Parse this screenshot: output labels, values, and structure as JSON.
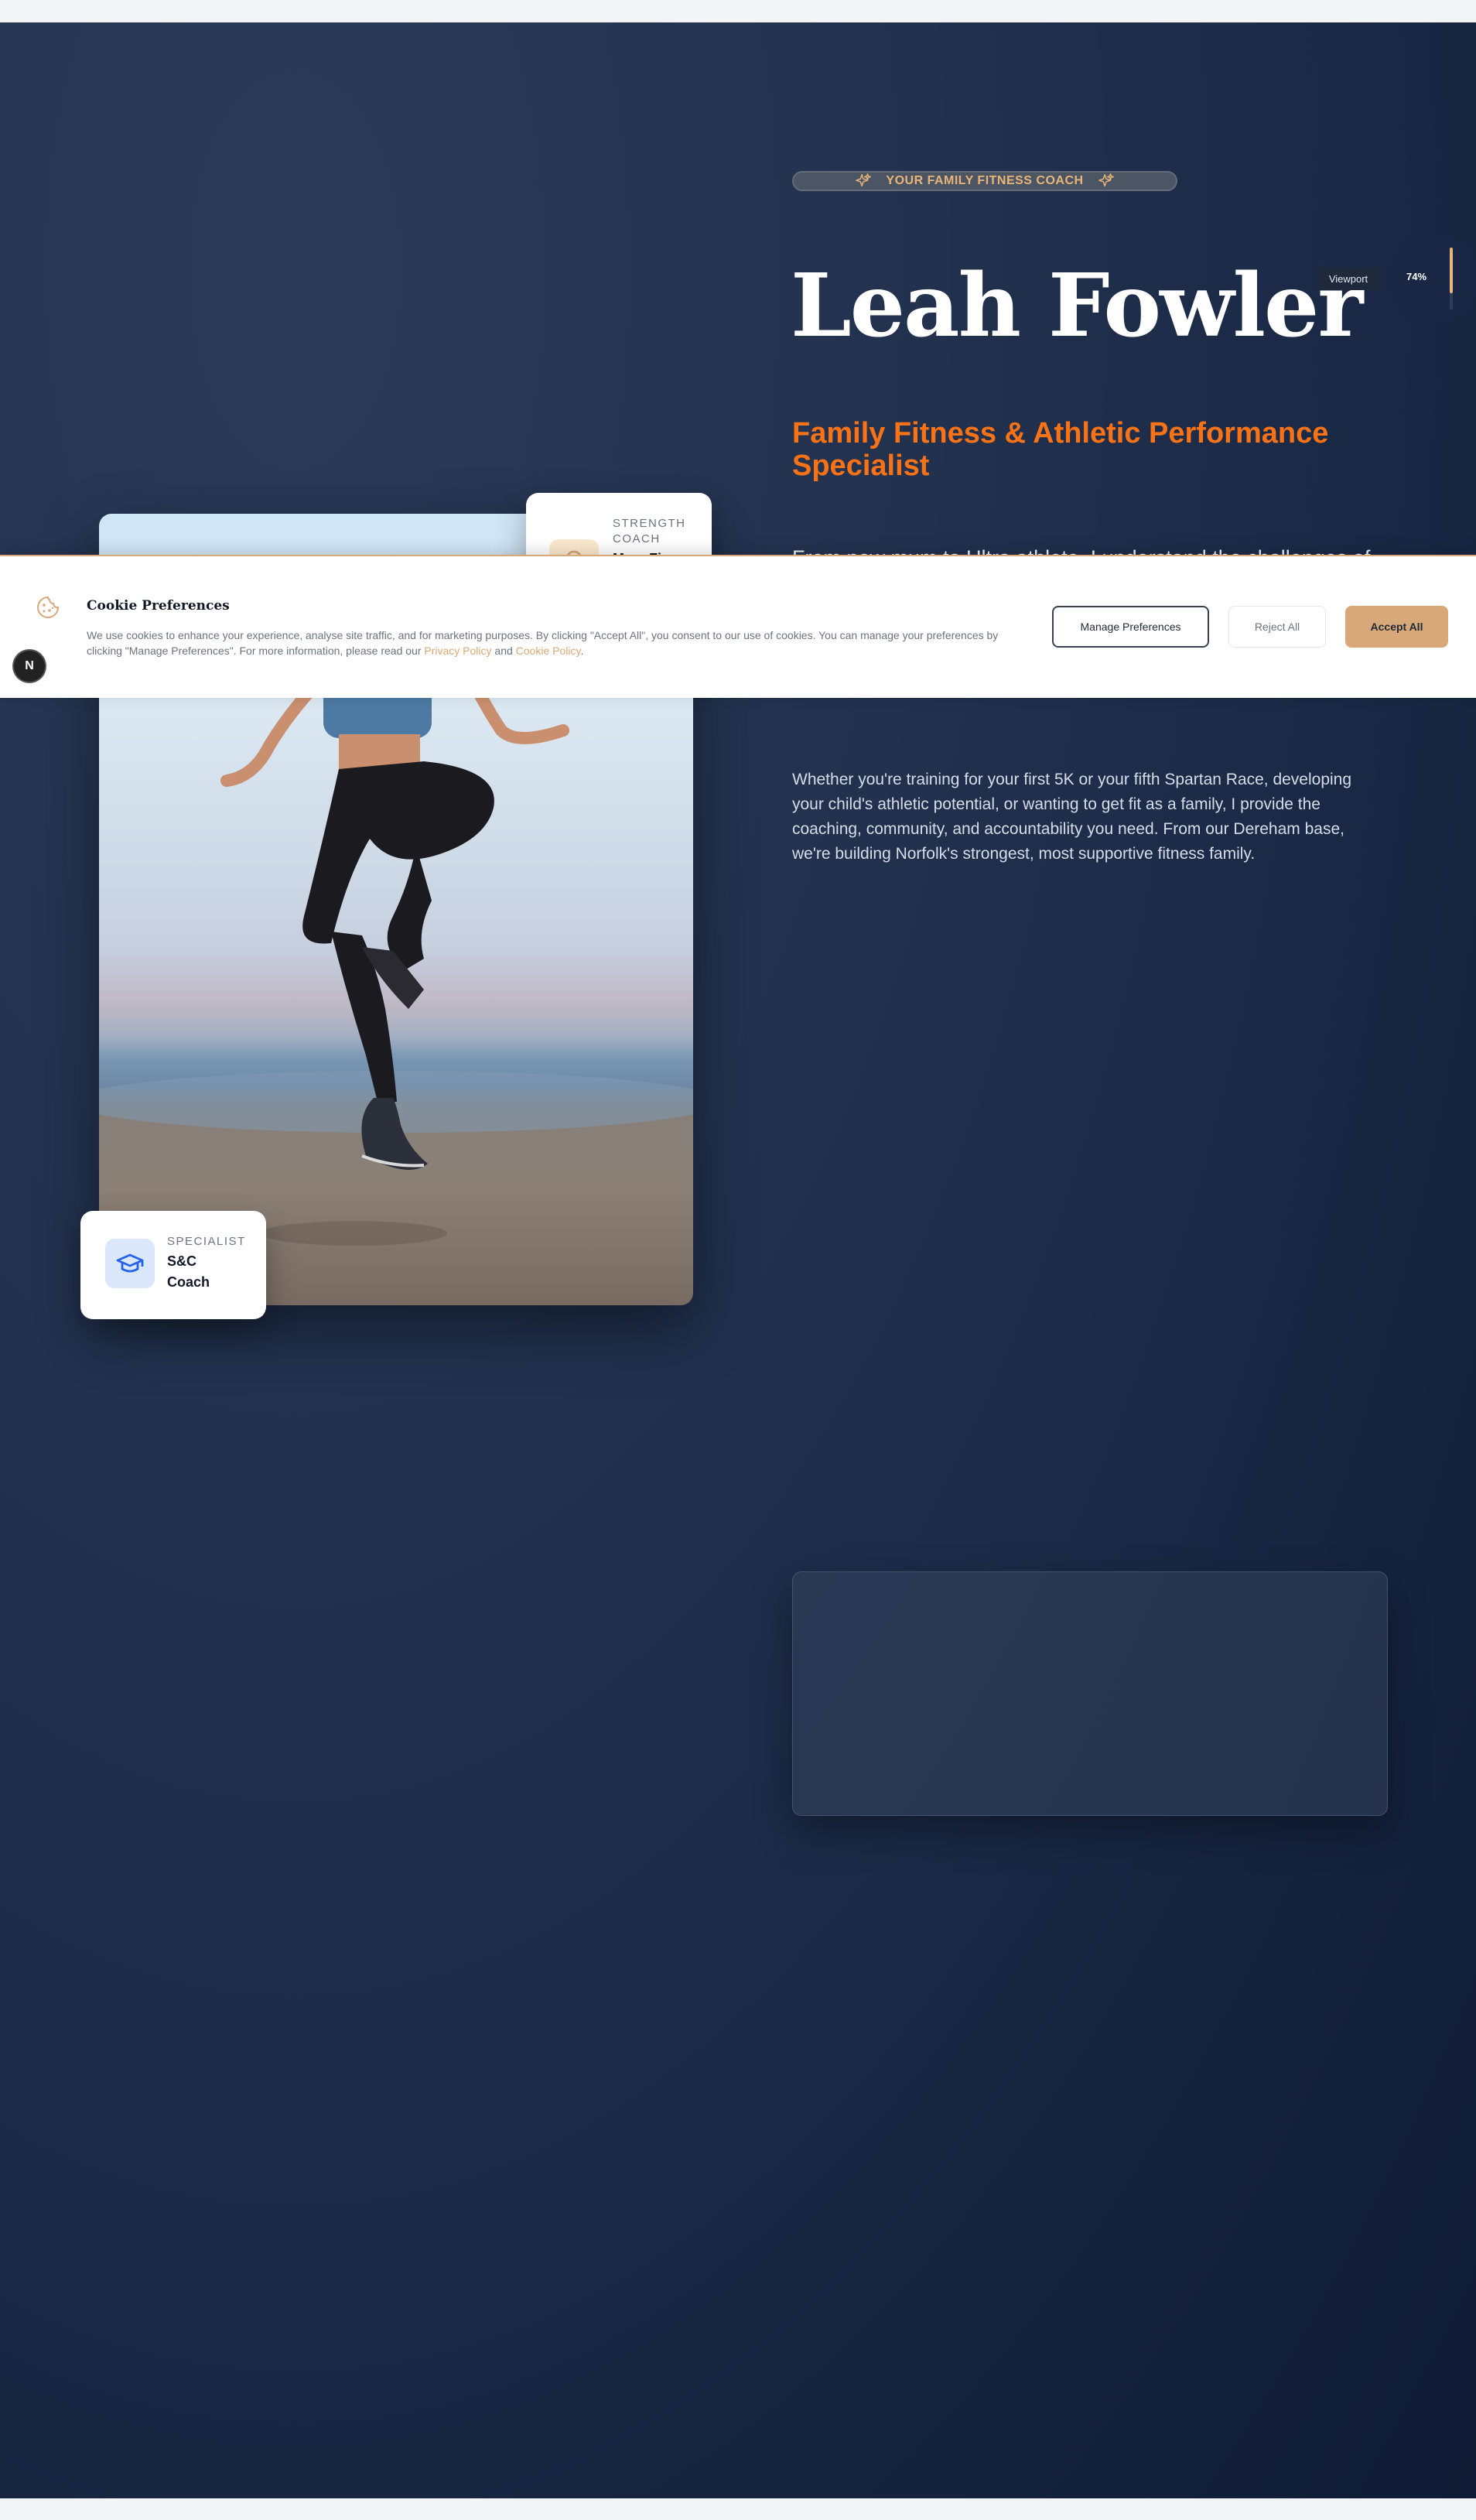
{
  "hero": {
    "badge": "YOUR FAMILY FITNESS COACH",
    "title": "Leah Fowler",
    "subtitle": "Family Fitness & Athletic Performance Specialist",
    "intro": "From new mum to Ultra athlete, I understand the challenges of",
    "body": "Whether you're training for your first 5K or your fifth Spartan Race, developing your child's athletic potential, or wanting to get fit as a family, I provide the coaching, community, and accountability you need. From our Dereham base, we're building Norfolk's strongest, most supportive fitness family."
  },
  "cards": {
    "strength": {
      "label": "STRENGTH COACH",
      "value": "Mum Fi...",
      "icon": "award-icon"
    },
    "specialist": {
      "label": "SPECIALIST",
      "value": "S&C Coach",
      "icon": "graduation-cap-icon"
    }
  },
  "viewport": {
    "label": "Viewport",
    "percent": "74%",
    "progress": 0.74
  },
  "cookie": {
    "title": "Cookie Preferences",
    "text_main": "We use cookies to enhance your experience, analyse site traffic, and for marketing purposes. By clicking \"Accept All\", you consent to our use of cookies. You can manage your preferences by clicking \"Manage Preferences\". For more information, please read our ",
    "privacy_link": "Privacy Policy",
    "and": " and ",
    "cookie_link": "Cookie Policy",
    "period": ".",
    "manage_label": "Manage Preferences",
    "reject_label": "Reject All",
    "accept_label": "Accept All",
    "dev_badge": "N"
  },
  "colors": {
    "accent": "#f97316",
    "gold": "#d9a878",
    "navy": "#1b2a47"
  }
}
